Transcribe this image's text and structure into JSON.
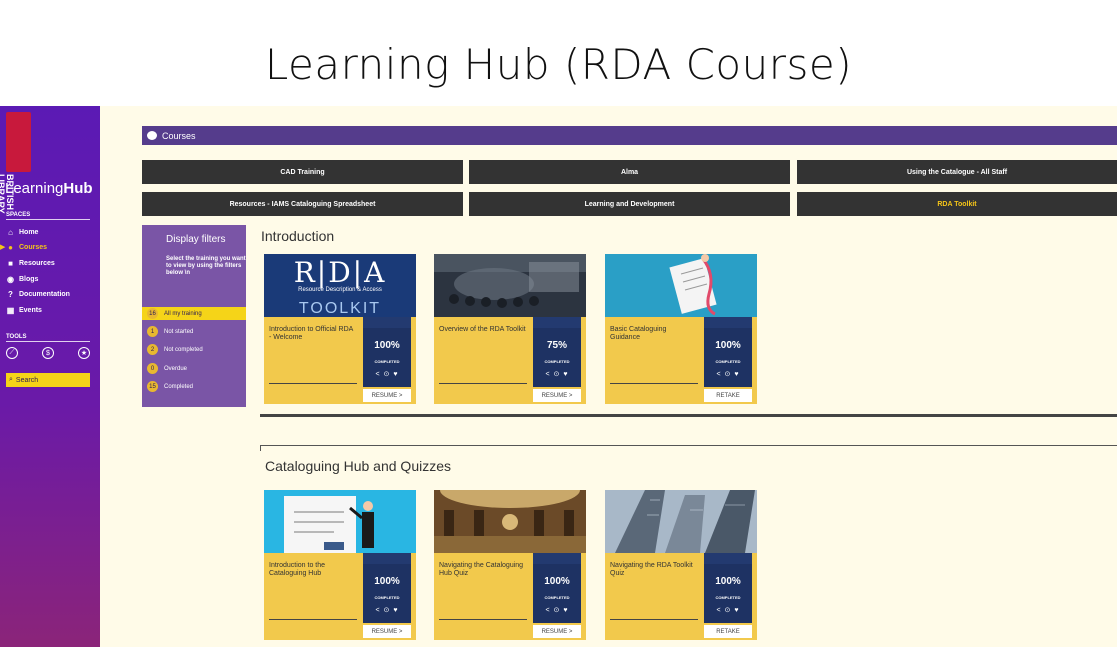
{
  "slide_title": "Learning Hub (RDA Course)",
  "colors": {
    "sidebar_purple": "#5b1ab4",
    "accent_yellow": "#f5d418",
    "courses_bar": "#553c8c",
    "category_button": "#333333",
    "card_yellow": "#f2c94c",
    "stat_navy": "#1e3263",
    "page_bg": "#fffbe8"
  },
  "sidebar": {
    "logo_text": "BRITISH LIBRARY",
    "brand_light": "Learning",
    "brand_bold": "Hub",
    "spaces_label": "SPACES",
    "items": [
      {
        "label": "Home",
        "icon": "home-icon"
      },
      {
        "label": "Courses",
        "icon": "courses-icon"
      },
      {
        "label": "Resources",
        "icon": "book-icon"
      },
      {
        "label": "Blogs",
        "icon": "chat-icon"
      },
      {
        "label": "Documentation",
        "icon": "help-icon"
      },
      {
        "label": "Events",
        "icon": "calendar-icon"
      }
    ],
    "tools_label": "TOOLS",
    "search_label": "Search"
  },
  "header": {
    "courses_label": "Courses"
  },
  "categories": [
    "CAD Training",
    "Alma",
    "Using the Catalogue - All Staff",
    "Resources - IAMS Cataloguing Spreadsheet",
    "Learning and Development",
    "RDA Toolkit"
  ],
  "filters": {
    "title": "Display filters",
    "description": "Select the training you want to view by using the filters below \\n",
    "items": [
      {
        "count": "16",
        "label": "All my training"
      },
      {
        "count": "1",
        "label": "Not started"
      },
      {
        "count": "2",
        "label": "Not completed"
      },
      {
        "count": "0",
        "label": "Overdue"
      },
      {
        "count": "15",
        "label": "Completed"
      }
    ]
  },
  "sections": [
    {
      "title": "Introduction",
      "cards": [
        {
          "title": "Introduction to Official RDA - Welcome",
          "pct": "100%",
          "status": "COMPLETED",
          "action": "RESUME >",
          "image": {
            "letters": "R|D|A",
            "subtitle": "Resource Description & Access",
            "word": "TOOLKIT"
          }
        },
        {
          "title": "Overview of the RDA Toolkit",
          "pct": "75%",
          "status": "COMPLETED",
          "action": "RESUME >"
        },
        {
          "title": "Basic Cataloguing Guidance",
          "pct": "100%",
          "status": "COMPLETED",
          "action": "RETAKE"
        }
      ]
    },
    {
      "title": "Cataloguing Hub and Quizzes",
      "cards": [
        {
          "title": "Introduction to the Cataloguing Hub",
          "pct": "100%",
          "status": "COMPLETED",
          "action": "RESUME >"
        },
        {
          "title": "Navigating the Cataloguing Hub  Quiz",
          "pct": "100%",
          "status": "COMPLETED",
          "action": "RESUME >"
        },
        {
          "title": "Navigating the RDA Toolkit Quiz",
          "pct": "100%",
          "status": "COMPLETED",
          "action": "RETAKE"
        }
      ]
    }
  ],
  "card_actions_icons": [
    "share-icon",
    "info-icon",
    "heart-icon"
  ]
}
